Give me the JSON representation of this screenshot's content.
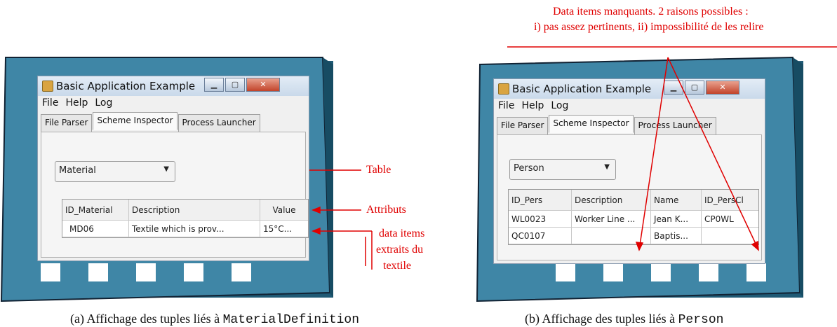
{
  "panel_a": {
    "window": {
      "title": "Basic Application Example",
      "menu": [
        "File",
        "Help",
        "Log"
      ],
      "tabs": [
        "File Parser",
        "Scheme Inspector",
        "Process Launcher"
      ],
      "selected_table": "Material",
      "columns": [
        "ID_Material",
        "Description",
        "Value"
      ],
      "rows": [
        [
          "MD06",
          "Textile which is prov...",
          "15°C..."
        ]
      ]
    },
    "annotations": {
      "table": "Table",
      "attributes": "Attributs",
      "data_items_1": "data items",
      "data_items_2": "extraits du",
      "data_items_3": "textile"
    },
    "caption_prefix": "(a)  Affichage des tuples liés à ",
    "caption_code": "MaterialDefinition"
  },
  "panel_b": {
    "window": {
      "title": "Basic Application Example",
      "menu": [
        "File",
        "Help",
        "Log"
      ],
      "tabs": [
        "File Parser",
        "Scheme Inspector",
        "Process Launcher"
      ],
      "selected_table": "Person",
      "columns": [
        "ID_Pers",
        "Description",
        "Name",
        "ID_PersCl"
      ],
      "rows": [
        [
          "WL0023",
          "Worker Line ...",
          "Jean K...",
          "CP0WL"
        ],
        [
          "QC0107",
          "",
          "Baptis...",
          ""
        ]
      ]
    },
    "annotations": {
      "missing_line1": "Data items manquants. 2 raisons possibles :",
      "missing_line2": "i) pas assez pertinents, ii) impossibilité de les relire"
    },
    "caption_prefix": "(b)  Affichage des tuples liés à ",
    "caption_code": "Person"
  },
  "colors": {
    "frame": "#3f86a6",
    "annotation": "#e00000"
  }
}
